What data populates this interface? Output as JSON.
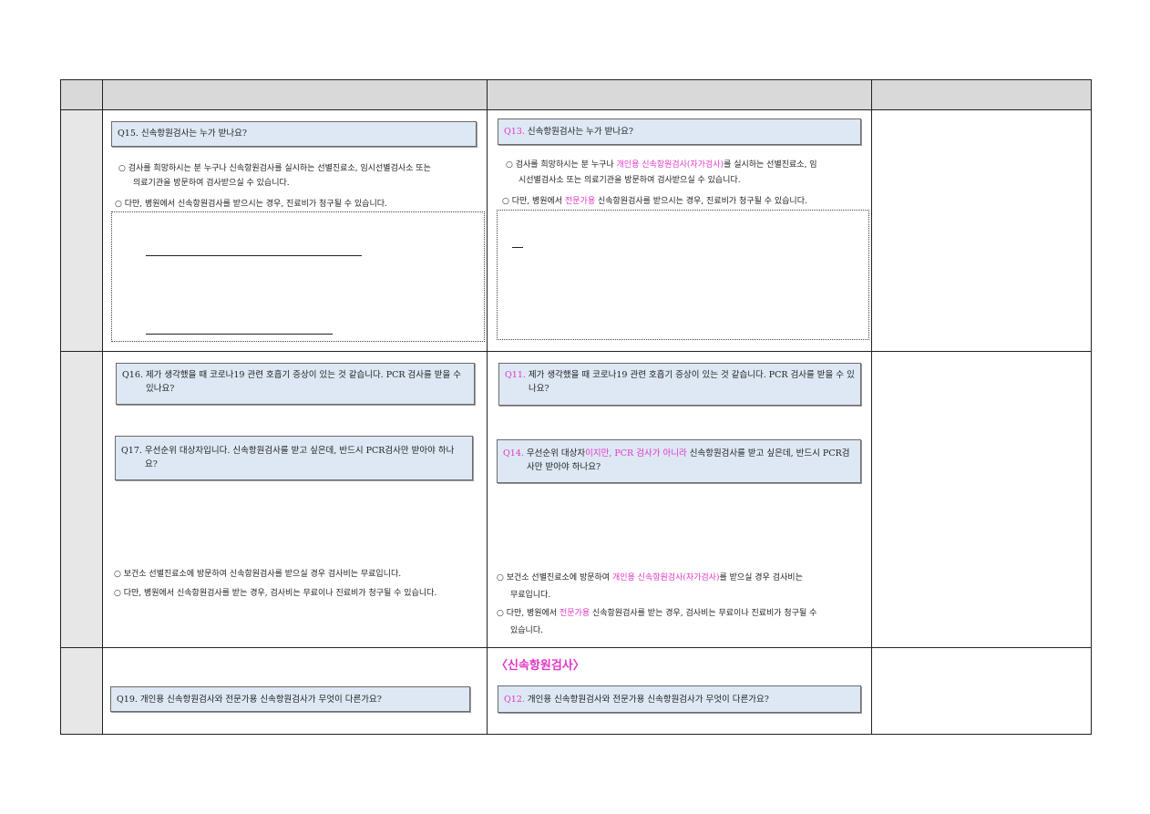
{
  "left": {
    "q15": "Q15. 신속항원검사는 누가 받나요?",
    "a15_1a": "○  검사를 희망하시는 분 누구나 신속항원검사를 실시하는 선별진료소, 임시선별검사소 또는",
    "a15_1b": "의료기관을 방문하여 검사받으실 수 있습니다.",
    "a15_2": "○  다만, 병원에서 신속항원검사를 받으시는 경우, 진료비가 청구될 수 있습니다.",
    "q16": "Q16. 제가 생각했을 때 코로나19 관련 호흡기 증상이 있는 것 같습니다. PCR 검사를 받을 수 있나요?",
    "q17": "Q17. 우선순위 대상자입니다. 신속항원검사를 받고 싶은데, 반드시 PCR검사만 받아야 하나요?",
    "a17_1": "○  보건소 선별진료소에 방문하여 신속항원검사를 받으실 경우 검사비는 무료입니다.",
    "a17_2": "○  다만, 병원에서 신속항원검사를 받는 경우, 검사비는 무료이나 진료비가 청구될 수 있습니다.",
    "q19": "Q19. 개인용 신속항원검사와 전문가용 신속항원검사가 무엇이 다른가요?"
  },
  "right": {
    "q13_num": "Q13.",
    "q13_text": " 신속항원검사는 누가 받나요?",
    "a13_1_pre": "○  검사를 희망하시는 분 누구나 ",
    "a13_1_pink": "개인용 신속항원검사(자가검사)",
    "a13_1_post": "를 실시하는 선별진료소, 임",
    "a13_1b": "시선별검사소 또는 의료기관을 방문하여 검사받으실 수 있습니다.",
    "a13_2_pre": "○  다만, 병원에서 ",
    "a13_2_pink": "전문가용",
    "a13_2_post": " 신속항원검사를 받으시는 경우, 진료비가 청구될 수 있습니다.",
    "q11_num": "Q11.",
    "q11_text": " 제가 생각했을 때 코로나19 관련 호흡기 증상이 있는 것 같습니다. PCR 검사를 받을 수 있나요?",
    "q14_num": "Q14.",
    "q14_t1": " 우선순위 대상자",
    "q14_pink": "이지만, PCR 검사가 아니라",
    "q14_t2": " 신속항원검사를 받고 싶은데, 반드시 PCR검사만 받아야 하나요?",
    "a14_1_pre": "○  보건소 선별진료소에 방문하여 ",
    "a14_1_pink": "개인용 신속항원검사(자가검사)",
    "a14_1_post": "를 받으실 경우 검사비는",
    "a14_1b": "무료입니다.",
    "a14_2_pre": "○  다만, 병원에서 ",
    "a14_2_pink": "전문가용",
    "a14_2_post": " 신속항원검사를 받는 경우, 검사비는 무료이나 진료비가 청구될 수",
    "a14_2b": "있습니다.",
    "heading": "〈신속항원검사〉",
    "q12_num": "Q12.",
    "q12_text": " 개인용 신속항원검사와 전문가용 신속항원검사가 무엇이 다른가요?"
  },
  "colors": {
    "accent": "#e234c8",
    "question_fill": "#dde8f4",
    "header_fill": "#d9d9d9"
  }
}
